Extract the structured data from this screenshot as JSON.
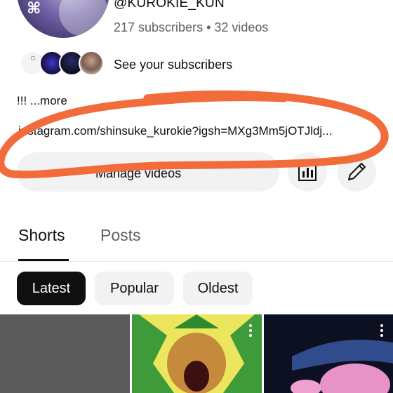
{
  "channel": {
    "handle": "@KUROKIE_KUN",
    "meta": "217 subscribers • 32 videos",
    "see_subscribers": "See your subscribers",
    "description": "!!! ...more",
    "link": "instagram.com/shinsuke_kurokie?igsh=MXg3Mm5jOTJldj...",
    "manage_videos_label": "Manage videos"
  },
  "icons": {
    "analytics": "analytics-icon",
    "edit": "pencil-icon",
    "more": "more-vertical-icon"
  },
  "tabs": [
    {
      "label": "Shorts",
      "active": true
    },
    {
      "label": "Posts",
      "active": false
    }
  ],
  "filters": [
    {
      "label": "Latest",
      "selected": true
    },
    {
      "label": "Popular",
      "selected": false
    },
    {
      "label": "Oldest",
      "selected": false
    }
  ],
  "colors": {
    "annotation": "#f26b3a",
    "chip_selected": "#0f0f0f",
    "chip_default": "#f2f2f2",
    "secondary_text": "#606060"
  }
}
